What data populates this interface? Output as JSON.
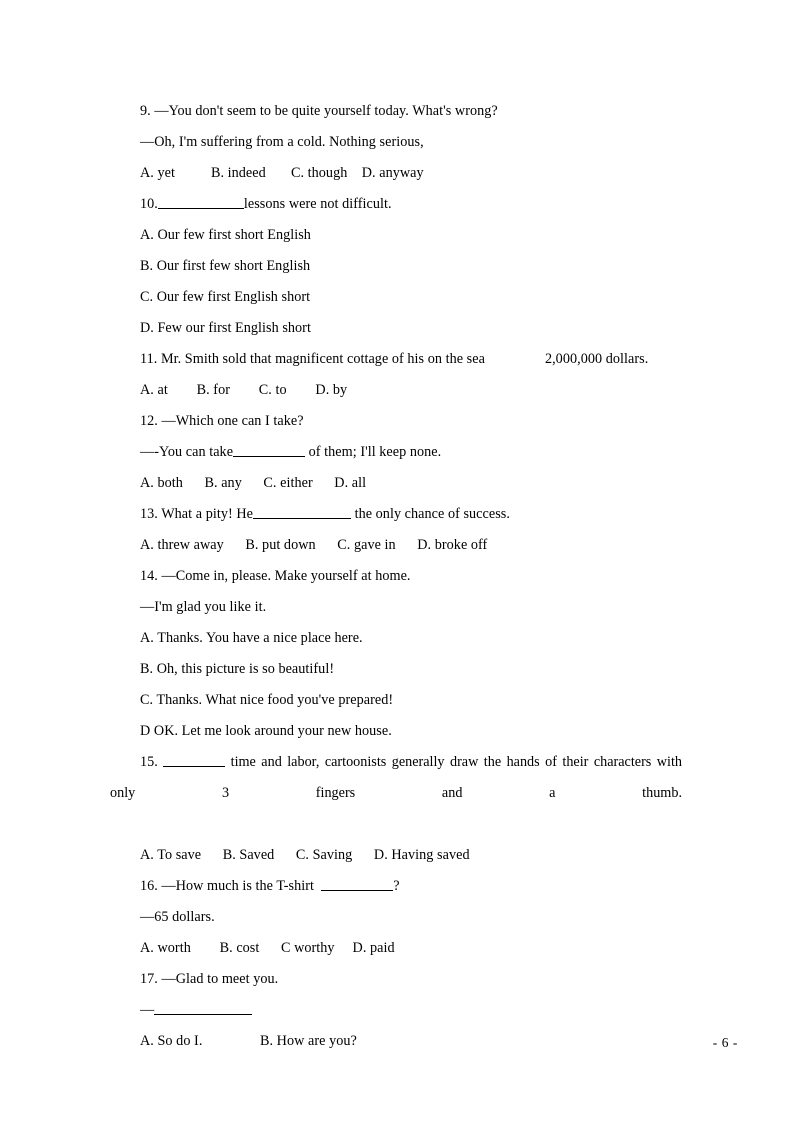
{
  "document": {
    "page_footer": "- 6 -",
    "ink_color": "#000000",
    "paper_color": "#ffffff"
  },
  "questions": [
    {
      "number": "9.",
      "stem": "9. —You don't seem to be quite yourself today. What's wrong?",
      "reply": "—Oh, I'm suffering from a cold. Nothing serious,",
      "options_line": "A. yet          B. indeed       C. though    D. anyway",
      "options": [
        {
          "label": "A.",
          "text": "yet"
        },
        {
          "label": "B.",
          "text": "indeed"
        },
        {
          "label": "C.",
          "text": "though"
        },
        {
          "label": "D.",
          "text": "anyway"
        }
      ]
    },
    {
      "number": "10.",
      "stem_before_blank": "10.",
      "stem_after_blank": "lessons were not difficult.",
      "options": [
        {
          "label": "A.",
          "text": "Our few first short English"
        },
        {
          "label": "B.",
          "text": "Our first few short English"
        },
        {
          "label": "C.",
          "text": "Our few first English short"
        },
        {
          "label": "D.",
          "text": "Few our first English short"
        }
      ],
      "option_lines": [
        "A. Our few first short English",
        "B. Our first few short English",
        "C. Our few first English short",
        "D. Few our first English short"
      ]
    },
    {
      "number": "11.",
      "stem_before_gap": "11. Mr. Smith sold that magnificent cottage of his on the sea",
      "stem_after_gap": "2,000,000 dollars.",
      "options_line": "A. at        B. for        C. to        D. by",
      "options": [
        {
          "label": "A.",
          "text": "at"
        },
        {
          "label": "B.",
          "text": "for"
        },
        {
          "label": "C.",
          "text": "to"
        },
        {
          "label": "D.",
          "text": "by"
        }
      ]
    },
    {
      "number": "12.",
      "stem": "12. —Which one can I take?",
      "reply_before_blank": "—-You can take",
      "reply_after_blank": " of them; I'll keep none.",
      "options_line": "A. both      B. any      C. either      D. all",
      "options": [
        {
          "label": "A.",
          "text": "both"
        },
        {
          "label": "B.",
          "text": "any"
        },
        {
          "label": "C.",
          "text": "either"
        },
        {
          "label": "D.",
          "text": "all"
        }
      ]
    },
    {
      "number": "13.",
      "stem_before_blank": "13. What a pity! He",
      "stem_after_blank": " the only chance of success.",
      "options_line": "A. threw away      B. put down      C. gave in      D. broke off",
      "options": [
        {
          "label": "A.",
          "text": "threw away"
        },
        {
          "label": "B.",
          "text": "put down"
        },
        {
          "label": "C.",
          "text": "gave in"
        },
        {
          "label": "D.",
          "text": "broke off"
        }
      ]
    },
    {
      "number": "14.",
      "stem": "14. —Come in, please. Make yourself at home.",
      "reply": "—I'm glad you like it.",
      "option_lines": [
        "A. Thanks. You have a nice place here.",
        "B. Oh, this picture is so beautiful!",
        "C. Thanks. What nice food you've prepared!",
        "D OK. Let me look around your new house."
      ],
      "options": [
        {
          "label": "A.",
          "text": "Thanks. You have a nice place here."
        },
        {
          "label": "B.",
          "text": "Oh, this picture is so beautiful!"
        },
        {
          "label": "C.",
          "text": "Thanks. What nice food you've prepared!"
        },
        {
          "label": "D",
          "text": "OK. Let me look around your new house."
        }
      ]
    },
    {
      "number": "15.",
      "stem_before_blank": "15.",
      "stem_after_blank": " time and labor, cartoonists generally draw the hands of their characters with only 3 fingers and a thumb.",
      "options_line": "A. To save      B. Saved      C. Saving      D. Having saved",
      "options": [
        {
          "label": "A.",
          "text": "To save"
        },
        {
          "label": "B.",
          "text": "Saved"
        },
        {
          "label": "C.",
          "text": "Saving"
        },
        {
          "label": "D.",
          "text": "Having saved"
        }
      ]
    },
    {
      "number": "16.",
      "stem_before_blank": "16. —How much is the T-shirt  ",
      "stem_after_blank": "?",
      "reply": "—65 dollars.",
      "options_line": "A. worth        B. cost      C worthy     D. paid",
      "options": [
        {
          "label": "A.",
          "text": "worth"
        },
        {
          "label": "B.",
          "text": "cost"
        },
        {
          "label": "C",
          "text": "worthy"
        },
        {
          "label": "D.",
          "text": "paid"
        }
      ]
    },
    {
      "number": "17.",
      "stem": "17. —Glad to meet you.",
      "reply_dash": "—",
      "options_line": "A. So do I.                B. How are you?",
      "options": [
        {
          "label": "A.",
          "text": "So do I."
        },
        {
          "label": "B.",
          "text": "How are you?"
        }
      ]
    }
  ]
}
